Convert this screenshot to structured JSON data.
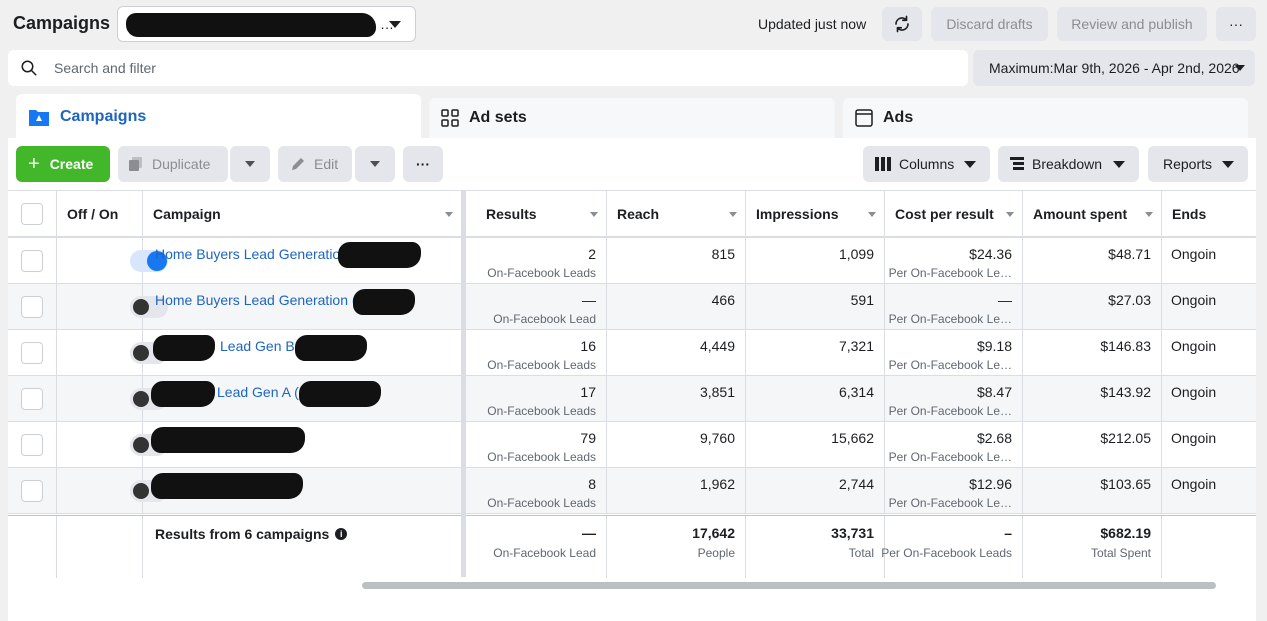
{
  "header": {
    "title": "Campaigns",
    "account_ellipsis": "…",
    "updated": "Updated just now",
    "discard": "Discard drafts",
    "review": "Review and publish",
    "more": "···"
  },
  "search": {
    "placeholder": "Search and filter"
  },
  "date_range": "Maximum:Mar 9th, 2026 - Apr 2nd, 2026",
  "tabs": [
    {
      "label": "Campaigns",
      "active": true
    },
    {
      "label": "Ad sets",
      "active": false
    },
    {
      "label": "Ads",
      "active": false
    }
  ],
  "toolbar": {
    "create": "Create",
    "duplicate": "Duplicate",
    "edit": "Edit",
    "more": "···",
    "columns": "Columns",
    "breakdown": "Breakdown",
    "reports": "Reports"
  },
  "columns": {
    "off_on": "Off / On",
    "campaign": "Campaign",
    "results": "Results",
    "reach": "Reach",
    "impressions": "Impressions",
    "cost_per_result": "Cost per result",
    "amount_spent": "Amount spent",
    "ends": "Ends"
  },
  "rows": [
    {
      "on": true,
      "name": "Home Buyers Lead Generation (",
      "results": "2",
      "results_sub": "On-Facebook Leads",
      "reach": "815",
      "impressions": "1,099",
      "cpr": "$24.36",
      "cpr_sub": "Per On-Facebook Le…",
      "spent": "$48.71",
      "ends": "Ongoin"
    },
    {
      "on": false,
      "name": "Home Buyers Lead Generation (",
      "results": "—",
      "results_sub": "On-Facebook Lead",
      "reach": "466",
      "impressions": "591",
      "cpr": "—",
      "cpr_sub": "Per On-Facebook Le…",
      "spent": "$27.03",
      "ends": "Ongoin"
    },
    {
      "on": false,
      "name": "Lead Gen B",
      "results": "16",
      "results_sub": "On-Facebook Leads",
      "reach": "4,449",
      "impressions": "7,321",
      "cpr": "$9.18",
      "cpr_sub": "Per On-Facebook Le…",
      "spent": "$146.83",
      "ends": "Ongoin"
    },
    {
      "on": false,
      "name": "Lead Gen A (",
      "results": "17",
      "results_sub": "On-Facebook Leads",
      "reach": "3,851",
      "impressions": "6,314",
      "cpr": "$8.47",
      "cpr_sub": "Per On-Facebook Le…",
      "spent": "$143.92",
      "ends": "Ongoin"
    },
    {
      "on": false,
      "name": "",
      "results": "79",
      "results_sub": "On-Facebook Leads",
      "reach": "9,760",
      "impressions": "15,662",
      "cpr": "$2.68",
      "cpr_sub": "Per On-Facebook Le…",
      "spent": "$212.05",
      "ends": "Ongoin"
    },
    {
      "on": false,
      "name": "",
      "results": "8",
      "results_sub": "On-Facebook Leads",
      "reach": "1,962",
      "impressions": "2,744",
      "cpr": "$12.96",
      "cpr_sub": "Per On-Facebook Le…",
      "spent": "$103.65",
      "ends": "Ongoin"
    }
  ],
  "totals": {
    "label": "Results from 6 campaigns",
    "info_icon": "i",
    "results": "—",
    "results_sub": "On-Facebook Lead",
    "reach": "17,642",
    "reach_sub": "People",
    "impressions": "33,731",
    "impressions_sub": "Total",
    "cpr": "–",
    "cpr_sub": "Per On-Facebook Leads",
    "spent": "$682.19",
    "spent_sub": "Total Spent"
  },
  "colors": {
    "accent": "#1877f2",
    "create": "#42b72a",
    "link": "#1d65c1"
  }
}
